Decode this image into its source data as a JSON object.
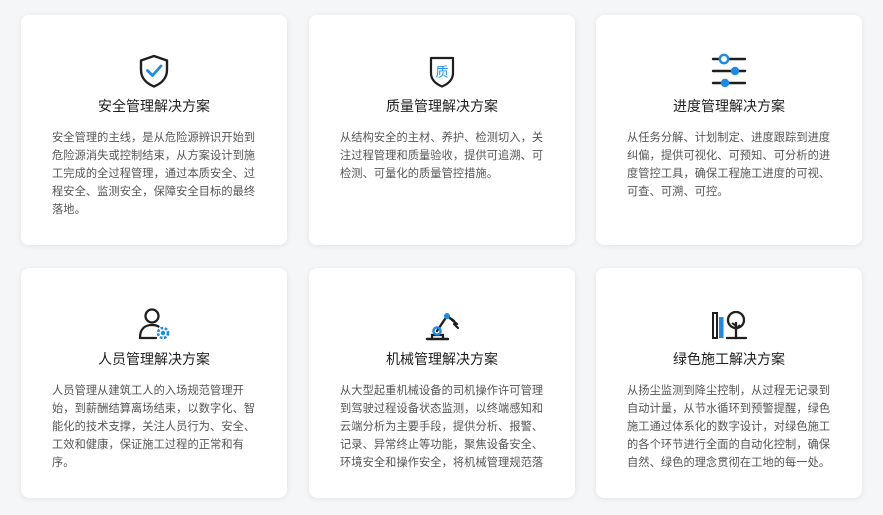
{
  "colors": {
    "accent": "#1a8ce8",
    "icon_dark": "#1f1f1f"
  },
  "cards": [
    {
      "icon": "shield-check-icon",
      "title": "安全管理解决方案",
      "desc": "安全管理的主线，是从危险源辨识开始到危险源消失或控制结束，从方案设计到施工完成的全过程管理，通过本质安全、过程安全、监测安全，保障安全目标的最终落地。"
    },
    {
      "icon": "quality-badge-icon",
      "title": "质量管理解决方案",
      "desc": "从结构安全的主材、养护、检测切入，关注过程管理和质量验收，提供可追溯、可检测、可量化的质量管控措施。",
      "icon_text": "质"
    },
    {
      "icon": "sliders-icon",
      "title": "进度管理解决方案",
      "desc": "从任务分解、计划制定、进度跟踪到进度纠偏，提供可视化、可预知、可分析的进度管控工具，确保工程施工进度的可视、可查、可溯、可控。"
    },
    {
      "icon": "worker-gear-icon",
      "title": "人员管理解决方案",
      "desc": "人员管理从建筑工人的入场规范管理开始，到薪酬结算离场结束，以数字化、智能化的技术支撑，关注人员行为、安全、工效和健康，保证施工过程的正常和有序。"
    },
    {
      "icon": "robot-arm-icon",
      "title": "机械管理解决方案",
      "desc": "从大型起重机械设备的司机操作许可管理到驾驶过程设备状态监测，以终端感知和云端分析为主要手段，提供分析、报警、记录、异常终止等功能，聚焦设备安全、环境安全和操作安全，将机械管理规范落"
    },
    {
      "icon": "green-tree-icon",
      "title": "绿色施工解决方案",
      "desc": "从扬尘监测到降尘控制，从过程无记录到自动计量，从节水循环到预警提醒，绿色施工通过体系化的数字设计，对绿色施工的各个环节进行全面的自动化控制，确保自然、绿色的理念贯彻在工地的每一处。"
    }
  ]
}
